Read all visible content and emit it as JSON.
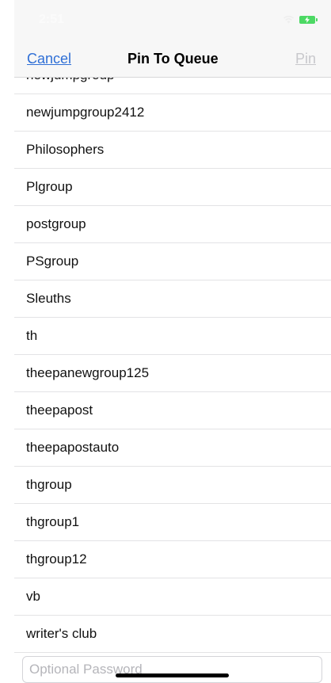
{
  "status_bar": {
    "time": "2:51",
    "wifi_icon": "wifi-icon",
    "battery_icon": "battery-charging-icon",
    "battery_color": "#4cd964"
  },
  "nav": {
    "cancel_label": "Cancel",
    "title": "Pin To Queue",
    "pin_label": "Pin",
    "link_color": "#2f6fd6",
    "disabled_color": "#c8c8cc"
  },
  "groups": [
    "newjumpgroup",
    "newjumpgroup2412",
    "Philosophers",
    "Plgroup",
    "postgroup",
    "PSgroup",
    "Sleuths",
    "th",
    "theepanewgroup125",
    "theepapost",
    "theepapostauto",
    "thgroup",
    "thgroup1",
    "thgroup12",
    "vb",
    "writer's club"
  ],
  "password": {
    "value": "",
    "placeholder": "Optional Password"
  }
}
